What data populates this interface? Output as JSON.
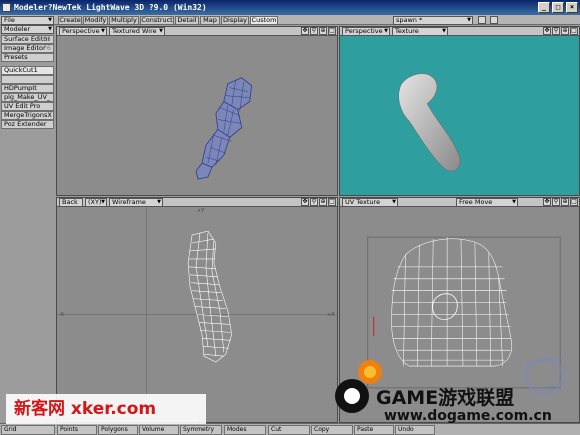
{
  "window": {
    "title": "Modeler?NewTek LightWave 3D ?9.0 (Win32)",
    "min": "_",
    "max": "□",
    "close": "×"
  },
  "menubar": {
    "file": "File",
    "tabs": [
      "Create",
      "Modify",
      "Multiply",
      "Construct",
      "Detail",
      "Map",
      "Display",
      "Custom"
    ],
    "active_tab": "Custom",
    "layer_select": "spawn *"
  },
  "sidebar": {
    "modeler": "Modeler",
    "items": [
      {
        "label": "Surface Editor",
        "key": "F5"
      },
      {
        "label": "Image Editor",
        "key": "F6"
      },
      {
        "label": "Presets",
        "key": ""
      },
      {
        "label": "QuickCut1",
        "key": ""
      },
      {
        "label": "",
        "key": ""
      },
      {
        "label": "HDPumpIt",
        "key": ""
      },
      {
        "label": "plg_Make_UV_",
        "key": ""
      },
      {
        "label": "UV Edit Pro",
        "key": ""
      },
      {
        "label": "MergeTrigonsX",
        "key": ""
      },
      {
        "label": "Poz Extender",
        "key": ""
      }
    ]
  },
  "viewports": {
    "tl": {
      "view": "Perspective",
      "mode": "Textured Wire"
    },
    "tr": {
      "view": "Perspective",
      "mode": "Texture"
    },
    "bl": {
      "view": "Back",
      "axis": "(XY)",
      "mode": "Wireframe"
    },
    "br": {
      "view": "UV Texture",
      "move": "Free Move"
    },
    "icons": [
      "✥",
      "⚲",
      "⊕",
      "□"
    ],
    "axis_labels": [
      "+Y",
      "-X",
      "+X",
      "-Y"
    ]
  },
  "colors": {
    "teal_bg": "#2e9e9e",
    "gray_bg": "#8c8c8c",
    "wire": "#3a4fa0",
    "watermark_red": "#d01818"
  },
  "statusbar": {
    "items": [
      "Grid",
      "Points",
      "Polygons",
      "Volume",
      "Symmetry",
      "Modes",
      "Cut",
      "Copy",
      "Paste",
      "Undo"
    ]
  },
  "watermarks": {
    "left": "新客网 xker.com",
    "right_game": "GAME游戏联盟",
    "right_url": "www.dogame.com.cn"
  }
}
